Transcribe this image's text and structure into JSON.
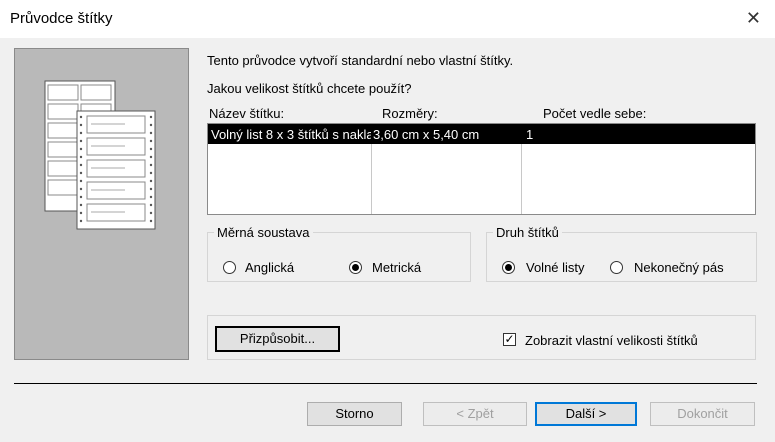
{
  "window": {
    "title": "Průvodce štítky",
    "close_glyph": "✕"
  },
  "intro_text": "Tento průvodce vytvoří standardní nebo vlastní štítky.",
  "question_text": "Jakou velikost štítků chcete použít?",
  "table": {
    "headers": [
      "Název štítku:",
      "Rozměry:",
      "Počet vedle sebe:"
    ],
    "rows": [
      {
        "name": "Volný list 8 x 3 štítků s nakla",
        "size": "3,60 cm x 5,40 cm",
        "count": "1",
        "selected": true
      }
    ]
  },
  "units_group": {
    "legend": "Měrná soustava",
    "options": [
      {
        "label": "Anglická",
        "selected": false
      },
      {
        "label": "Metrická",
        "selected": true
      }
    ]
  },
  "type_group": {
    "legend": "Druh štítků",
    "options": [
      {
        "label": "Volné listy",
        "selected": true
      },
      {
        "label": "Nekonečný pás",
        "selected": false
      }
    ]
  },
  "customize_button": "Přizpůsobit...",
  "show_custom_checkbox": {
    "label": "Zobrazit vlastní velikosti štítků",
    "checked": true
  },
  "footer_buttons": {
    "cancel": "Storno",
    "back": "< Zpět",
    "next": "Další >",
    "finish": "Dokončit"
  },
  "colors": {
    "selection": "#000000",
    "accent": "#0078d7",
    "panel": "#b9b9b9"
  }
}
